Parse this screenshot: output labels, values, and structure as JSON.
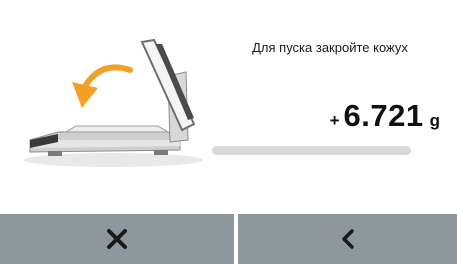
{
  "screen": {
    "message": "Для пуска закройте кожух",
    "weight": {
      "sign": "+",
      "value": "6.721",
      "unit": "g"
    },
    "progress": {
      "fraction": 0.0
    }
  },
  "footer": {
    "cancel_icon": "close-icon",
    "back_icon": "chevron-left-icon"
  },
  "colors": {
    "button_background": "#8e989c",
    "arrow": "#f2a126",
    "progress_track": "#d9d9d9",
    "icon": "#1a1a1a"
  }
}
